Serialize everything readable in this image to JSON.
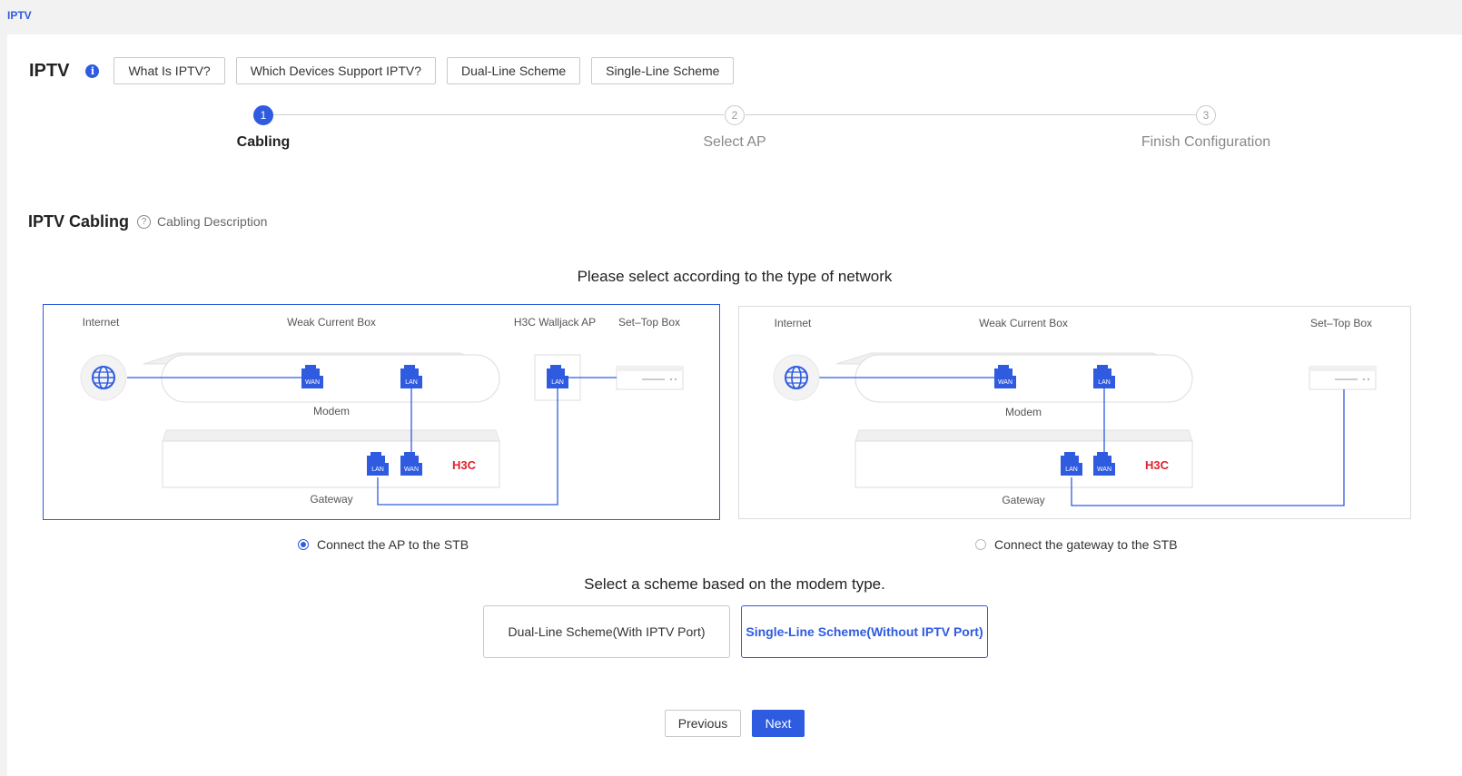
{
  "breadcrumb": "IPTV",
  "header": {
    "title": "IPTV",
    "info_icon": "i",
    "buttons": [
      "What Is IPTV?",
      "Which Devices Support IPTV?",
      "Dual-Line Scheme",
      "Single-Line Scheme"
    ]
  },
  "steps": [
    {
      "num": "1",
      "label": "Cabling",
      "state": "active"
    },
    {
      "num": "2",
      "label": "Select AP",
      "state": "inactive"
    },
    {
      "num": "3",
      "label": "Finish Configuration",
      "state": "inactive"
    }
  ],
  "section": {
    "title": "IPTV Cabling",
    "help_icon": "?",
    "help_text": "Cabling Description"
  },
  "network_prompt": "Please select according to the type of network",
  "diagrams": {
    "ap": {
      "internet": "Internet",
      "weak_current_box": "Weak Current Box",
      "walljack_ap": "H3C Walljack AP",
      "stb": "Set–Top Box",
      "modem": "Modem",
      "gateway": "Gateway",
      "wan": "WAN",
      "lan": "LAN",
      "brand": "H3C"
    },
    "gateway": {
      "internet": "Internet",
      "weak_current_box": "Weak Current Box",
      "stb": "Set–Top Box",
      "modem": "Modem",
      "gateway": "Gateway",
      "wan": "WAN",
      "lan": "LAN",
      "brand": "H3C"
    }
  },
  "options": {
    "ap_stb": "Connect the AP to the STB",
    "gateway_stb": "Connect the gateway to the STB",
    "selected": "ap_stb"
  },
  "scheme_prompt": "Select a scheme based on the modem type.",
  "schemes": {
    "dual": "Dual-Line Scheme(With IPTV Port)",
    "single": "Single-Line Scheme(Without IPTV Port)",
    "selected": "single"
  },
  "nav": {
    "previous": "Previous",
    "next": "Next"
  },
  "colors": {
    "accent": "#2f5be0",
    "brand_red": "#e0202c"
  },
  "icons": {
    "info": "info-icon",
    "help": "question-circle-icon",
    "internet": "globe-icon",
    "port": "ethernet-port-icon"
  }
}
